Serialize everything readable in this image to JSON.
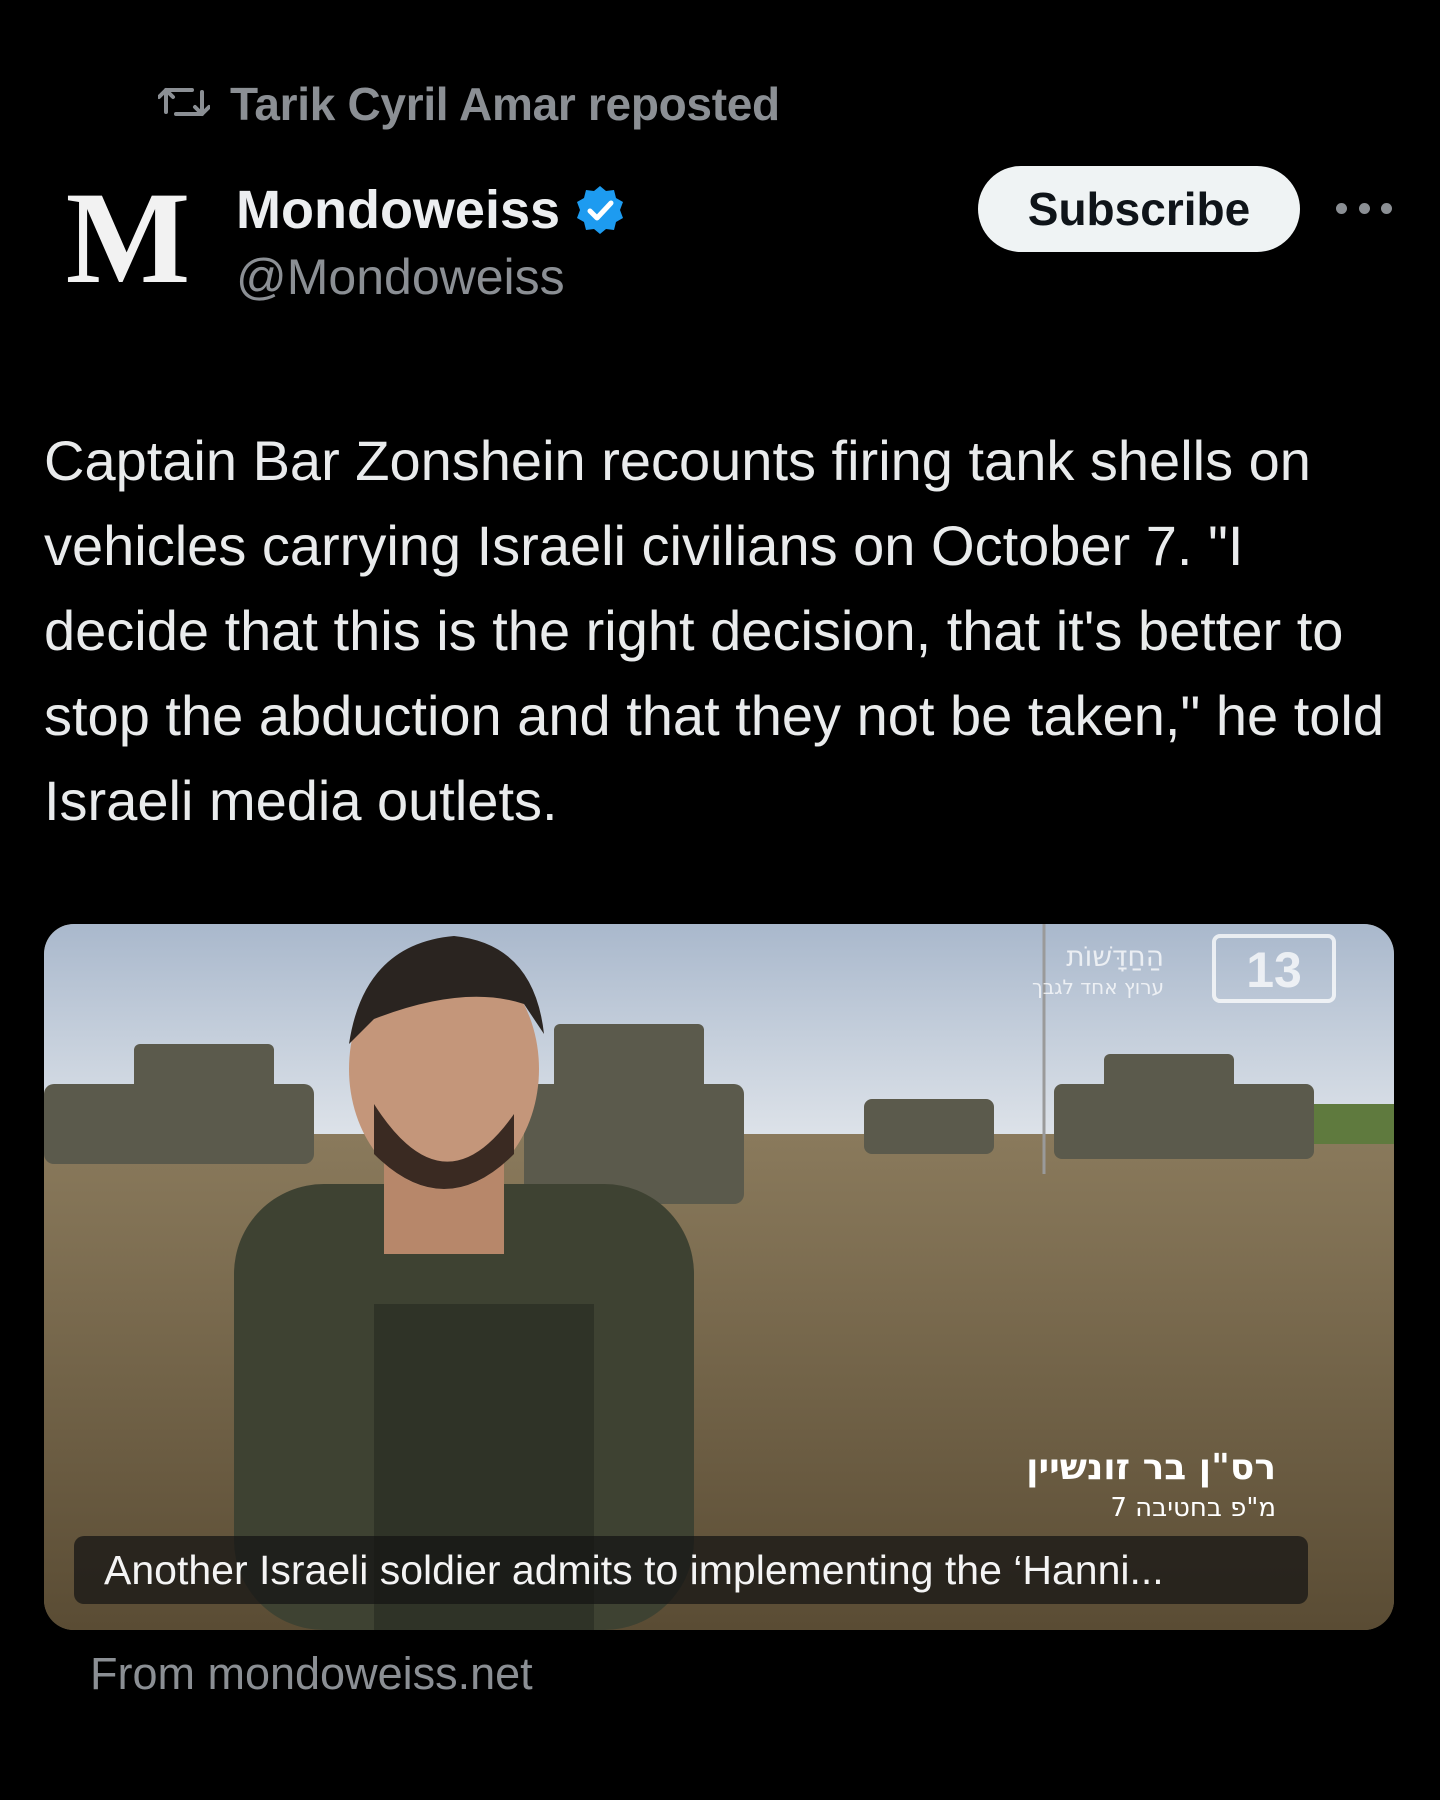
{
  "repost": {
    "text": "Tarik Cyril Amar reposted",
    "icon": "repost-icon"
  },
  "author": {
    "avatar_letter": "M",
    "display_name": "Mondoweiss",
    "handle": "@Mondoweiss",
    "verified": true,
    "verified_color": "#1d9bf0"
  },
  "actions": {
    "subscribe_label": "Subscribe",
    "more_icon": "more-horizontal-icon"
  },
  "tweet": {
    "text": "Captain Bar Zonshein recounts firing tank shells on vehicles carrying Israeli civilians on October 7. \"I decide that this is the right decision, that it's better to stop the abduction and that they not be taken,\" he told Israeli media outlets."
  },
  "media": {
    "caption": "Another Israeli soldier admits to implementing the ‘Hanni...",
    "channel_number": "13",
    "channel_text": "הַחַדָּשׁוֹת",
    "channel_subtext": "ערוץ אחד לגבך",
    "chyron_name": "רס\"ן בר זונשיין",
    "chyron_sub": "מ\"פ בחטיבה 7"
  },
  "link_source": "From mondoweiss.net",
  "colors": {
    "background": "#000000",
    "text": "#e7e9ea",
    "muted": "#8b8f94",
    "accent": "#1d9bf0"
  }
}
